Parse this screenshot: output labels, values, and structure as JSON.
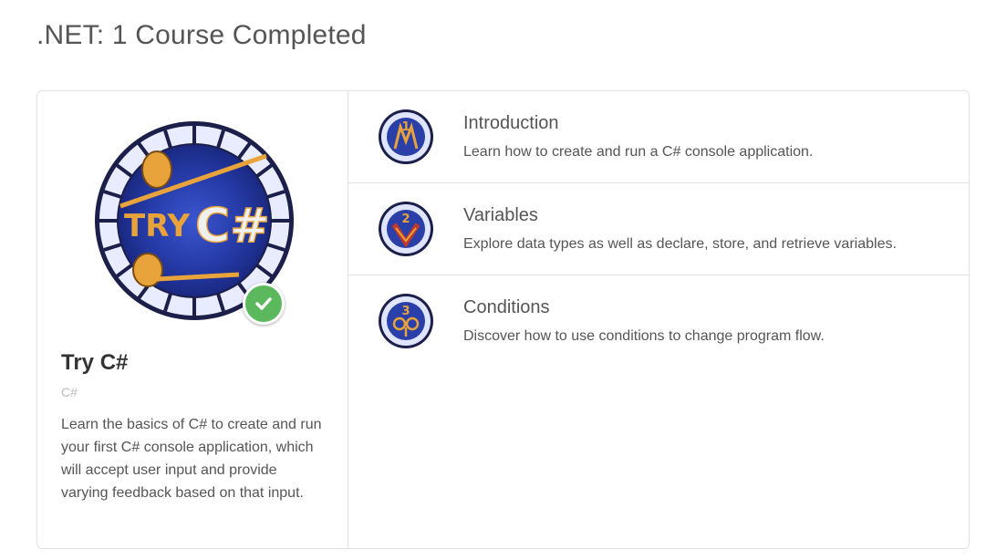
{
  "page": {
    "heading": ".NET: 1 Course Completed"
  },
  "course": {
    "title": "Try C#",
    "tag": "C#",
    "description": "Learn the basics of C# to create and run your first C# console application, which will accept user input and provide varying feedback based on that input.",
    "badge_text_try": "TRY",
    "badge_text_csharp": "C#",
    "completed_icon": "checkmark-icon",
    "colors": {
      "complete_green": "#5cb85c",
      "badge_blue": "#2a3fa8",
      "badge_gold": "#e8a33a"
    }
  },
  "modules": [
    {
      "number": "1",
      "title": "Introduction",
      "description": "Learn how to create and run a C# console application."
    },
    {
      "number": "2",
      "title": "Variables",
      "description": "Explore data types as well as declare, store, and retrieve variables."
    },
    {
      "number": "3",
      "title": "Conditions",
      "description": "Discover how to use conditions to change program flow."
    }
  ]
}
